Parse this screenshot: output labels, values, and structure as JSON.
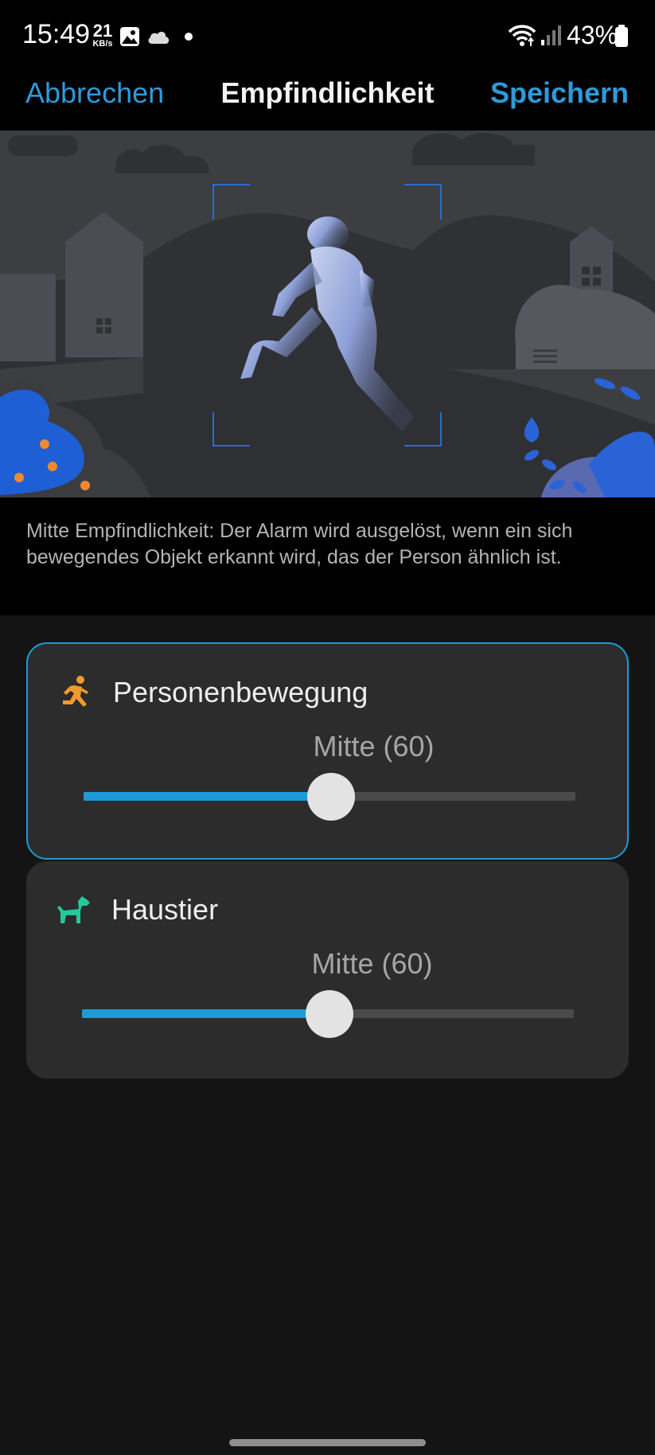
{
  "status_bar": {
    "time": "15:49",
    "net_speed_value": "21",
    "net_speed_unit": "KB/s",
    "battery_percent": "43%",
    "icons": [
      "gallery-icon",
      "cloud-icon",
      "notification-dot-icon",
      "wifi-icon",
      "signal-icon",
      "battery-icon"
    ]
  },
  "header": {
    "cancel_label": "Abbrechen",
    "title": "Empfindlichkeit",
    "save_label": "Speichern"
  },
  "description": "Mitte Empfindlichkeit: Der Alarm wird ausgelöst, wenn ein sich bewegendes Objekt erkannt wird, das der Person ähnlich ist.",
  "detection_cards": [
    {
      "title": "Personenbewegung",
      "icon": "running-person-icon",
      "icon_color": "#f39a2e",
      "value_label": "Mitte (60)",
      "value": 60,
      "max": 100,
      "selected": true
    },
    {
      "title": "Haustier",
      "icon": "dog-icon",
      "icon_color": "#22c99a",
      "value_label": "Mitte (60)",
      "value": 60,
      "max": 100,
      "selected": false
    }
  ],
  "colors": {
    "accent": "#1d9ad7",
    "card_background": "#2c2c2c",
    "page_background": "#141414"
  }
}
